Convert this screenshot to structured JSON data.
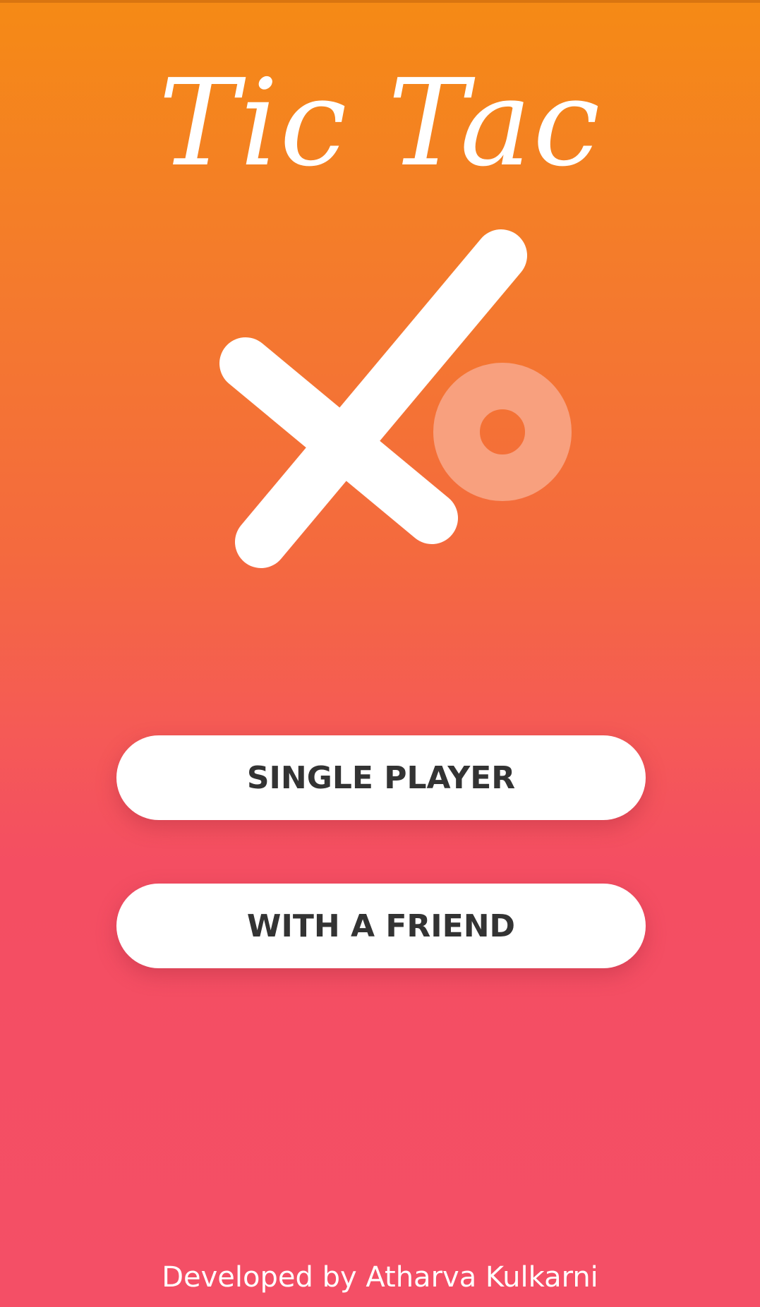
{
  "app": {
    "title": "Tic Tac"
  },
  "logo": {
    "icon": "x-and-o-logo-icon",
    "x_color": "#FFFFFF",
    "o_color": "#F8A07E"
  },
  "menu": {
    "single_player_label": "SINGLE PLAYER",
    "with_friend_label": "WITH A FRIEND"
  },
  "footer": {
    "credits": "Developed by Atharva Kulkarni"
  },
  "colors": {
    "gradient_top": "#F58A15",
    "gradient_bottom": "#F44F66",
    "button_background": "#FFFFFF",
    "button_text": "#333333"
  }
}
